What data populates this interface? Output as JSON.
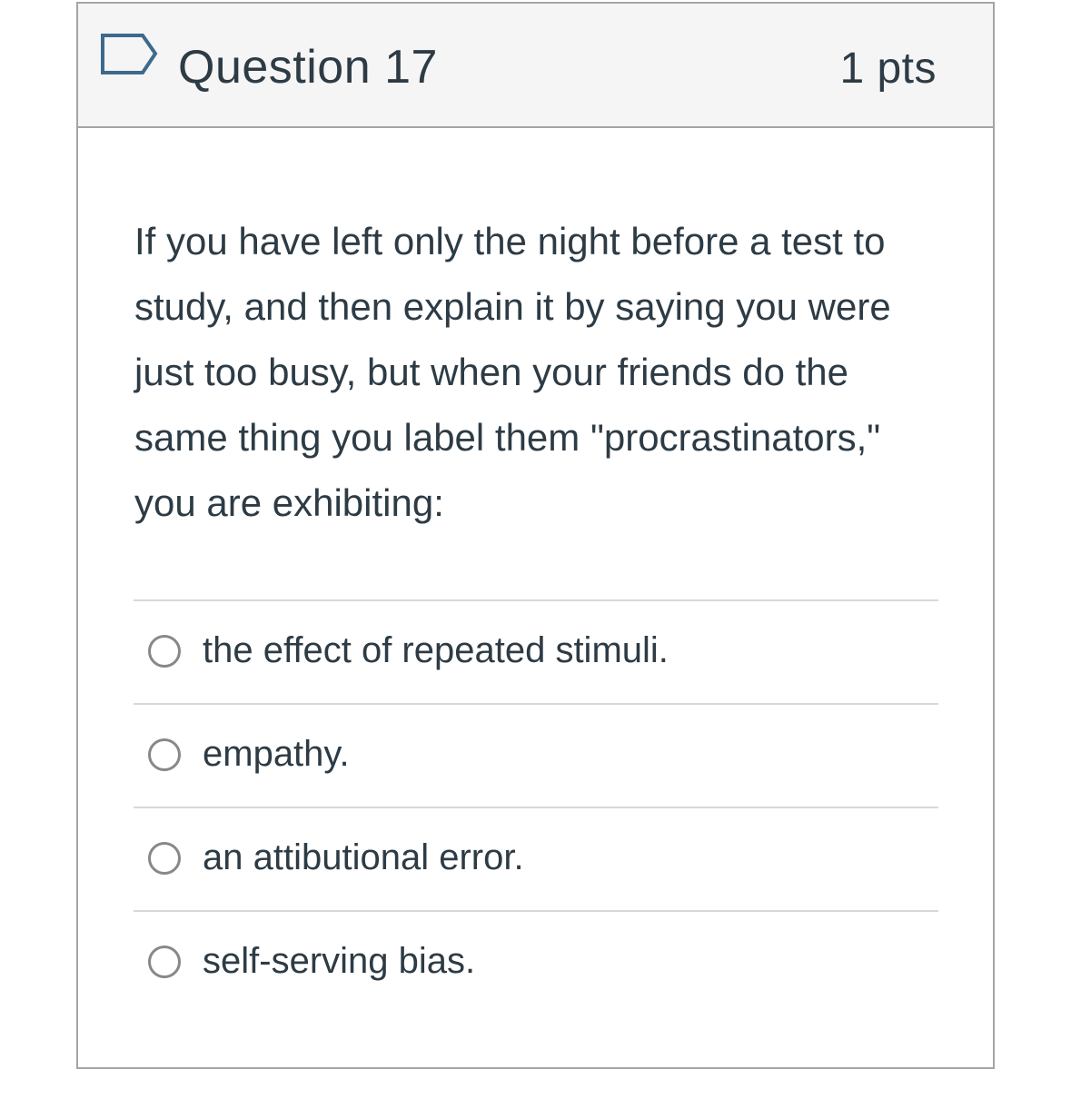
{
  "question": {
    "title": "Question 17",
    "points": "1 pts",
    "flag_icon": "flag-outline-icon",
    "text": "If you have left only the night before a test to study, and then explain it by saying you were just too busy, but when your friends do the same thing you label them \"procrastinators,\" you are exhibiting:"
  },
  "answers": [
    {
      "label": "the effect of repeated stimuli.",
      "selected": false
    },
    {
      "label": "empathy.",
      "selected": false
    },
    {
      "label": "an attibutional error.",
      "selected": false
    },
    {
      "label": "self-serving bias.",
      "selected": false
    }
  ],
  "colors": {
    "header_background": "#f5f5f5",
    "border": "#a5a5a5",
    "text": "#2d3b45",
    "flag_stroke": "#3d6a8c",
    "radio_border": "#888888",
    "divider": "#d8d8d8"
  }
}
